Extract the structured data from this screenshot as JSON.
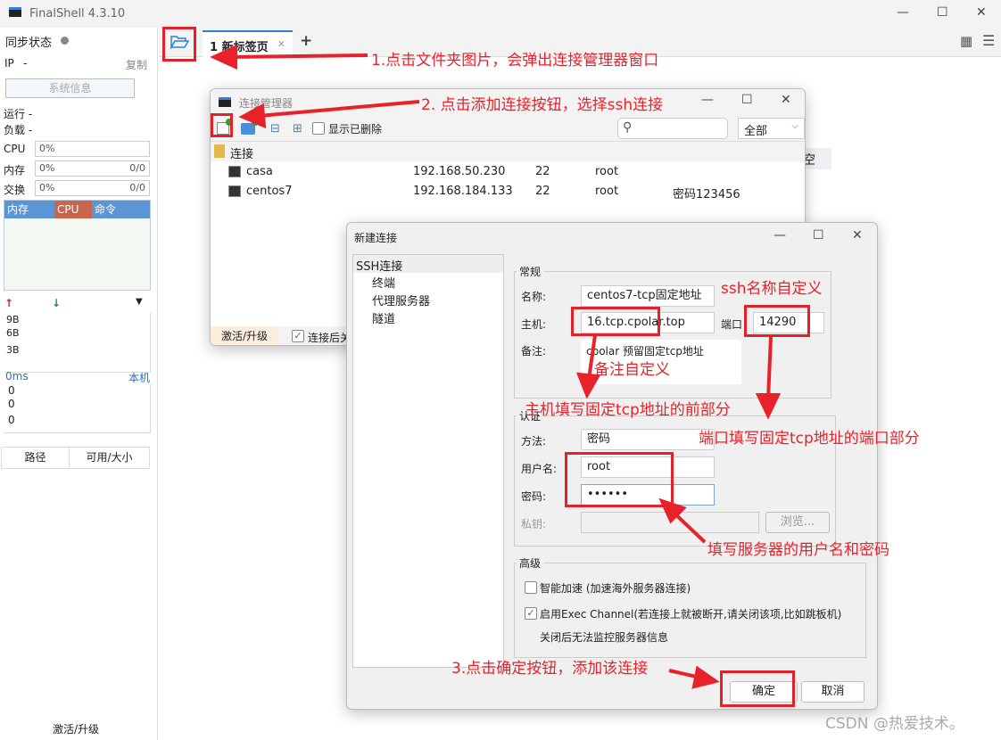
{
  "app": {
    "title": "FinalShell 4.3.10"
  },
  "sidebar": {
    "sync_status": "同步状态",
    "ip_label": "IP",
    "ip_value": "-",
    "copy": "复制",
    "sysinfo": "系统信息",
    "run": "运行 -",
    "load": "负载 -",
    "cpu_label": "CPU",
    "cpu_value": "0%",
    "mem_label": "内存",
    "mem_value": "0%",
    "mem_ratio": "0/0",
    "swap_label": "交换",
    "swap_value": "0%",
    "swap_ratio": "0/0",
    "tabs": [
      "内存",
      "CPU",
      "命令"
    ],
    "net_ticks": [
      "9B",
      "6B",
      "3B"
    ],
    "ping": "0ms",
    "local": "本机",
    "ping_ticks": [
      "0",
      "0",
      "0"
    ],
    "cols": [
      "路径",
      "可用/大小"
    ],
    "activate": "激活/升级"
  },
  "tabs": [
    {
      "label": "1 新标签页"
    }
  ],
  "manager": {
    "title": "连接管理器",
    "show_deleted": "显示已删除",
    "filter": "全部",
    "group": "连接",
    "rows": [
      {
        "name": "casa",
        "host": "192.168.50.230",
        "port": "22",
        "user": "root",
        "note": ""
      },
      {
        "name": "centos7",
        "host": "192.168.184.133",
        "port": "22",
        "user": "root",
        "note": "密码123456"
      }
    ],
    "activate": "激活/升级",
    "after_connect": "连接后关",
    "behind_text": "空"
  },
  "dialog": {
    "title": "新建连接",
    "tree": [
      "SSH连接",
      "终端",
      "代理服务器",
      "隧道"
    ],
    "general": "常规",
    "name_label": "名称:",
    "name": "centos7-tcp固定地址",
    "host_label": "主机:",
    "host": "16.tcp.cpolar.top",
    "port_label": "端口",
    "port": "14290",
    "note_label": "备注:",
    "note": "cpolar 预留固定tcp地址",
    "auth": "认证",
    "method_label": "方法:",
    "method": "密码",
    "user_label": "用户名:",
    "user": "root",
    "pwd_label": "密码:",
    "pwd": "••••••",
    "key_label": "私钥:",
    "browse": "浏览...",
    "advanced": "高级",
    "opt1": "智能加速 (加速海外服务器连接)",
    "opt2": "启用Exec Channel(若连接上就被断开,请关闭该项,比如跳板机)",
    "opt2_note": "关闭后无法监控服务器信息",
    "ok": "确定",
    "cancel": "取消"
  },
  "annotations": [
    "1.点击文件夹图片，会弹出连接管理器窗口",
    "2. 点击添加连接按钮，选择ssh连接",
    "ssh名称自定义",
    "备注自定义",
    "主机填写固定tcp地址的前部分",
    "端口填写固定tcp地址的端口部分",
    "填写服务器的用户名和密码",
    "3.点击确定按钮，添加该连接"
  ],
  "watermark": "CSDN @热爱技术。"
}
